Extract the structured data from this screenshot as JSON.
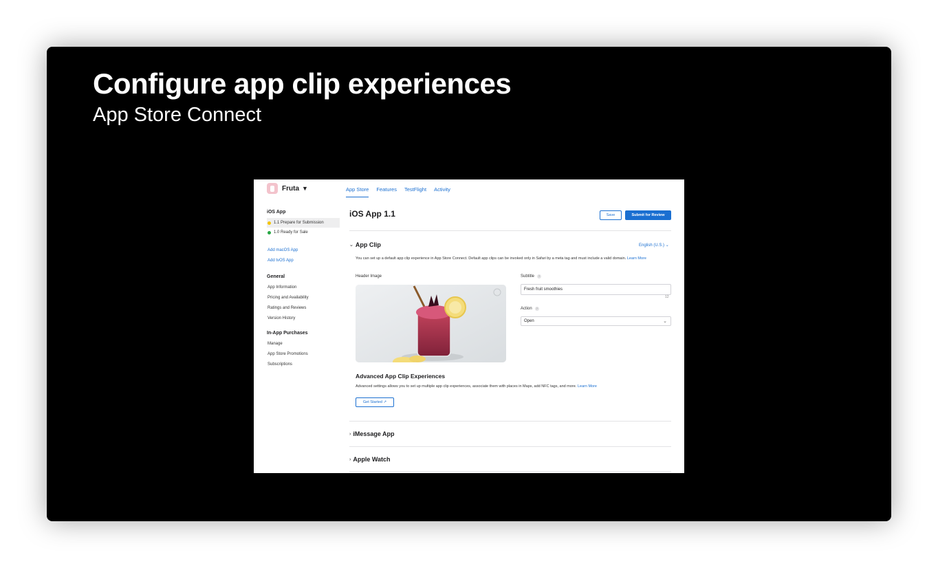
{
  "slide": {
    "title": "Configure app clip experiences",
    "subtitle": "App Store Connect"
  },
  "app": {
    "name": "Fruta",
    "icon": "fruta-app-icon",
    "tabs": [
      "App Store",
      "Features",
      "TestFlight",
      "Activity"
    ],
    "active_tab": "App Store"
  },
  "sidebar": {
    "ios_heading": "iOS App",
    "versions": [
      {
        "label": "1.1 Prepare for Submission",
        "status_color": "#f5c400",
        "selected": true
      },
      {
        "label": "1.0 Ready for Sale",
        "status_color": "#28a745",
        "selected": false
      }
    ],
    "add_links": [
      "Add macOS App",
      "Add tvOS App"
    ],
    "general_heading": "General",
    "general_items": [
      "App Information",
      "Pricing and Availability",
      "Ratings and Reviews",
      "Version History"
    ],
    "iap_heading": "In-App Purchases",
    "iap_items": [
      "Manage",
      "App Store Promotions",
      "Subscriptions"
    ]
  },
  "main": {
    "page_title": "iOS App 1.1",
    "save_label": "Save",
    "submit_label": "Submit for Review",
    "app_clip": {
      "title": "App Clip",
      "language": "English (U.S.)",
      "description": "You can set up a default app clip experience in App Store Connect. Default app clips can be invoked only in Safari by a meta tag and must include a valid domain.",
      "learn_more": "Learn More",
      "header_image_label": "Header Image",
      "subtitle_label": "Subtitle",
      "subtitle_value": "Fresh fruit smoothies",
      "subtitle_counter": "12",
      "action_label": "Action",
      "action_value": "Open"
    },
    "advanced": {
      "title": "Advanced App Clip Experiences",
      "description": "Advanced settings allows you to set up multiple app clip experiences, associate them with places in Maps, add NFC tags, and more.",
      "learn_more": "Learn More",
      "get_started_label": "Get Started ↗"
    },
    "imessage_title": "iMessage App",
    "watch_title": "Apple Watch"
  },
  "colors": {
    "accent": "#1a6fd1",
    "slide_background": "#000000"
  }
}
